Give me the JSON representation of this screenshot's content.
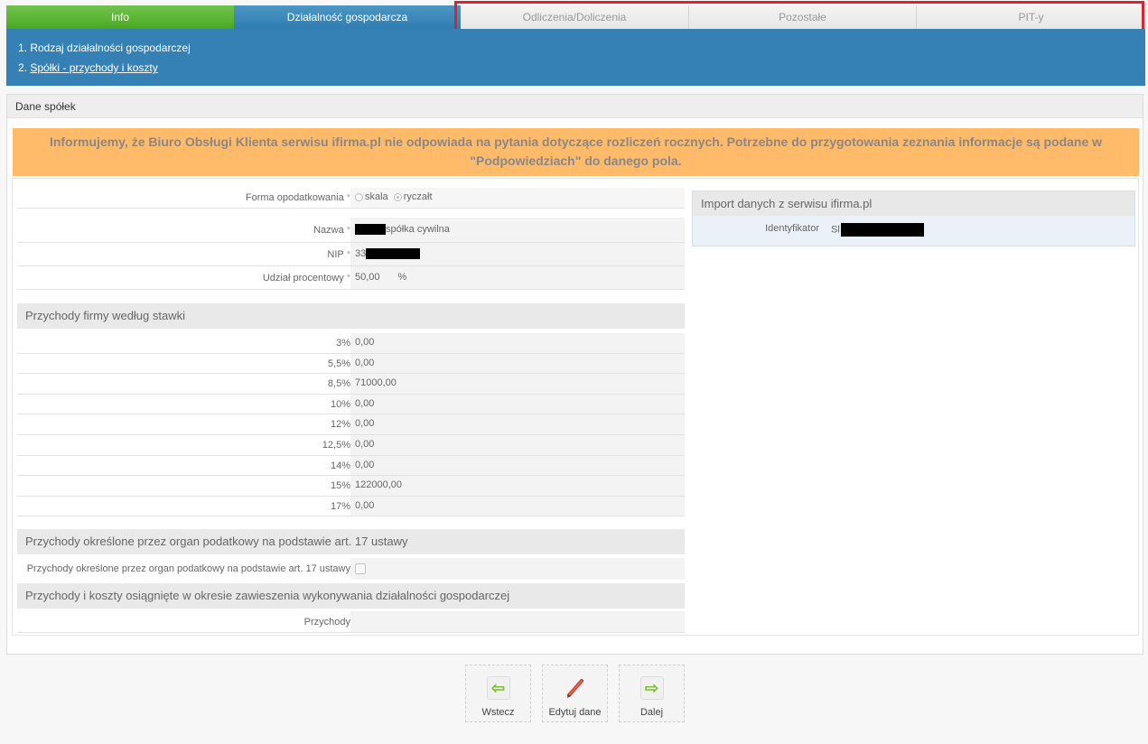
{
  "tabs": {
    "info": "Info",
    "dzialalnosc": "Działalność gospodarcza",
    "odliczenia": "Odliczenia/Doliczenia",
    "pozostale": "Pozostałe",
    "pity": "PIT-y"
  },
  "subnav": {
    "item1": "1. Rodzaj działalności gospodarczej",
    "item2_num": "2. ",
    "item2_link": "Spółki - przychody i koszty"
  },
  "panel": {
    "title": "Dane spółek",
    "notice": "Informujemy, że Biuro Obsługi Klienta serwisu ifirma.pl nie odpowiada na pytania dotyczące rozliczeń rocznych. Potrzebne do przygotowania zeznania informacje są podane w \"Podpowiedziach\" do danego pola."
  },
  "form": {
    "forma_label": "Forma opodatkowania",
    "opt_skala": "skala",
    "opt_ryczalt": "ryczałt",
    "nazwa_label": "Nazwa",
    "nazwa_value": "spółka cywilna",
    "nip_label": "NIP",
    "nip_prefix": "33",
    "udzial_label": "Udział procentowy",
    "udzial_value": "50,00",
    "udzial_unit": "%",
    "star": "*"
  },
  "przychody": {
    "title": "Przychody firmy według stawki",
    "rows": [
      {
        "rate": "3%",
        "value": "0,00"
      },
      {
        "rate": "5,5%",
        "value": "0,00"
      },
      {
        "rate": "8,5%",
        "value": "71000,00"
      },
      {
        "rate": "10%",
        "value": "0,00"
      },
      {
        "rate": "12%",
        "value": "0,00"
      },
      {
        "rate": "12,5%",
        "value": "0,00"
      },
      {
        "rate": "14%",
        "value": "0,00"
      },
      {
        "rate": "15%",
        "value": "122000,00"
      },
      {
        "rate": "17%",
        "value": "0,00"
      }
    ]
  },
  "art17": {
    "title": "Przychody określone przez organ podatkowy na podstawie art. 17 ustawy",
    "row_label": "Przychody określone przez organ podatkowy na podstawie art. 17 ustawy"
  },
  "zawieszenie": {
    "title": "Przychody i koszty osiągnięte w okresie zawieszenia wykonywania działalności gospodarczej",
    "row_label": "Przychody"
  },
  "import": {
    "title": "Import danych z serwisu ifirma.pl",
    "id_label": "Identyfikator",
    "id_prefix": "Sl"
  },
  "buttons": {
    "back": "Wstecz",
    "edit": "Edytuj dane",
    "next": "Dalej"
  },
  "colors": {
    "tab_green": "#4aa824",
    "tab_blue": "#2f7eb2",
    "notice_bg": "#ffba6a",
    "highlight_red": "#e0222d"
  }
}
